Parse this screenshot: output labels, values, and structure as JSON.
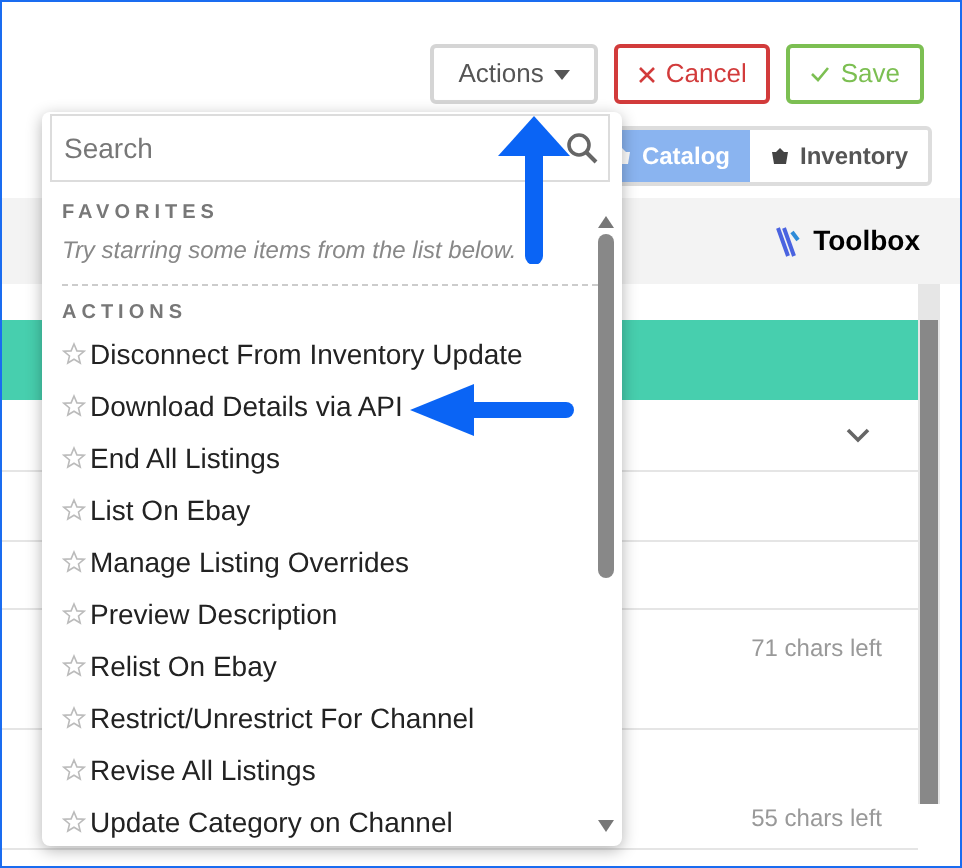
{
  "header_buttons": [
    {
      "label": "Actions",
      "kind": "dropdown"
    },
    {
      "label": "Cancel",
      "kind": "cancel"
    },
    {
      "label": "Save",
      "kind": "save"
    }
  ],
  "view_toggle": [
    {
      "label": "Catalog",
      "selected": true
    },
    {
      "label": "Inventory",
      "selected": false
    }
  ],
  "toolbox": {
    "label": "Toolbox"
  },
  "rows": [
    {
      "kind": "chevron"
    },
    {
      "kind": "blank"
    },
    {
      "kind": "blank"
    },
    {
      "kind": "counter",
      "text": "71 chars left"
    },
    {
      "kind": "counter",
      "text": "55 chars left"
    }
  ],
  "menu": {
    "search": {
      "placeholder": "Search"
    },
    "favorites": {
      "title": "FAVORITES",
      "hint": "Try starring some items from the list below."
    },
    "actions": {
      "title": "ACTIONS",
      "items": [
        {
          "label": "Disconnect From Inventory Update"
        },
        {
          "label": "Download Details via API"
        },
        {
          "label": "End All Listings"
        },
        {
          "label": "List On Ebay"
        },
        {
          "label": "Manage Listing Overrides"
        },
        {
          "label": "Preview Description"
        },
        {
          "label": "Relist On Ebay"
        },
        {
          "label": "Restrict/Unrestrict For Channel"
        },
        {
          "label": "Revise All Listings"
        },
        {
          "label": "Update Category on Channel"
        }
      ]
    }
  }
}
